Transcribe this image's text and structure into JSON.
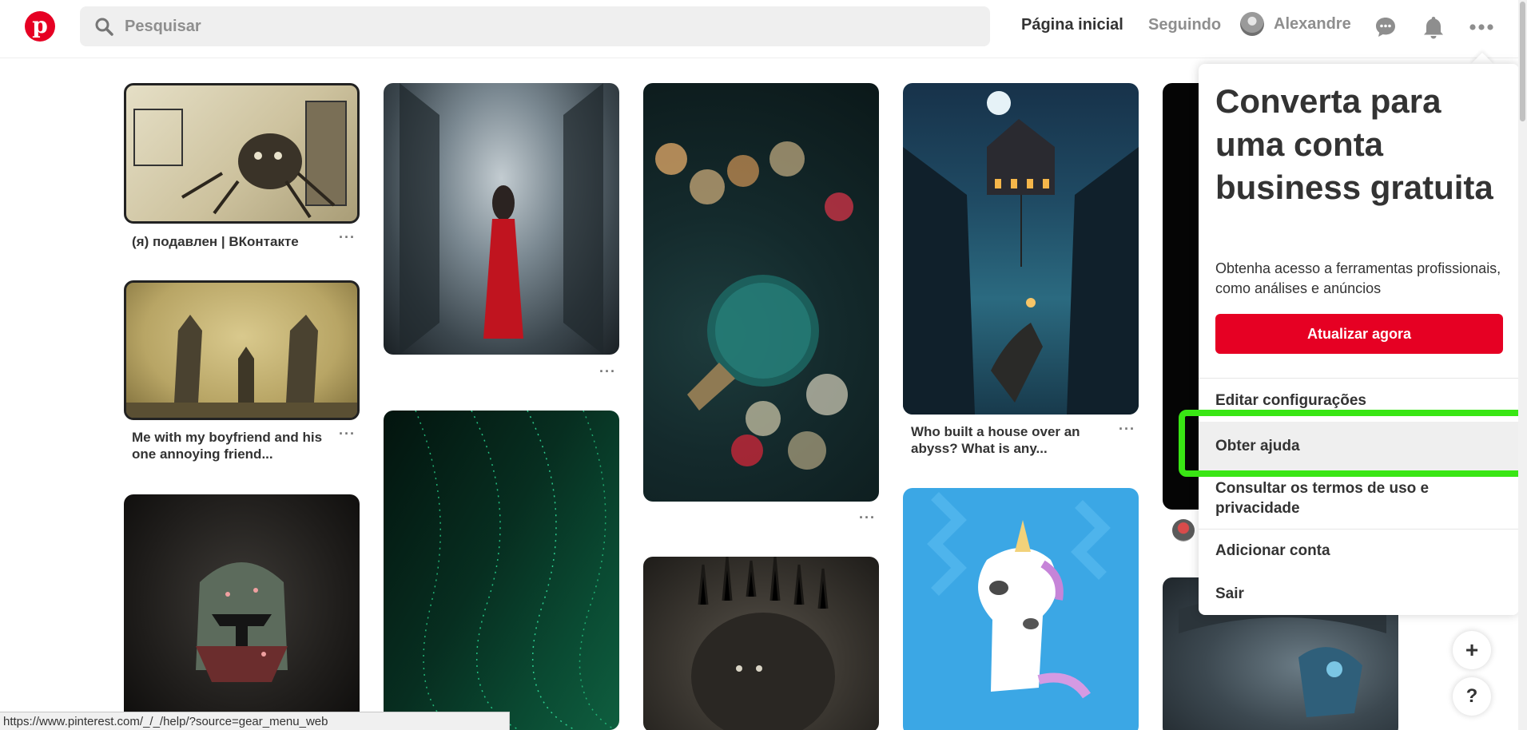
{
  "header": {
    "logo_letter": "p",
    "search_placeholder": "Pesquisar",
    "nav_home": "Página inicial",
    "nav_following": "Seguindo",
    "user_name": "Alexandre"
  },
  "pins": [
    {
      "title": "(я) подавлен | ВКонтакте",
      "dots": "···"
    },
    {
      "title": "Me with my boyfriend and his one annoying friend...",
      "dots": "···"
    },
    {
      "title": "",
      "dots": "···"
    },
    {
      "title": "",
      "dots": "···"
    },
    {
      "title": "Who built a house over an abyss? What is any...",
      "dots": "···"
    }
  ],
  "menu": {
    "promo_title": "Converta para uma conta business gratuita",
    "promo_subtitle": "Obtenha acesso a ferramentas profissionais, como análises e anúncios",
    "upgrade_button": "Atualizar agora",
    "items": [
      "Editar configurações",
      "Obter ajuda",
      "Consultar os termos de uso e privacidade",
      "Adicionar conta",
      "Sair"
    ]
  },
  "fab": {
    "add": "+",
    "help": "?"
  },
  "statusbar": {
    "url": "https://www.pinterest.com/_/_/help/?source=gear_menu_web"
  },
  "colors": {
    "brand": "#e60023",
    "highlight": "#39e614"
  }
}
